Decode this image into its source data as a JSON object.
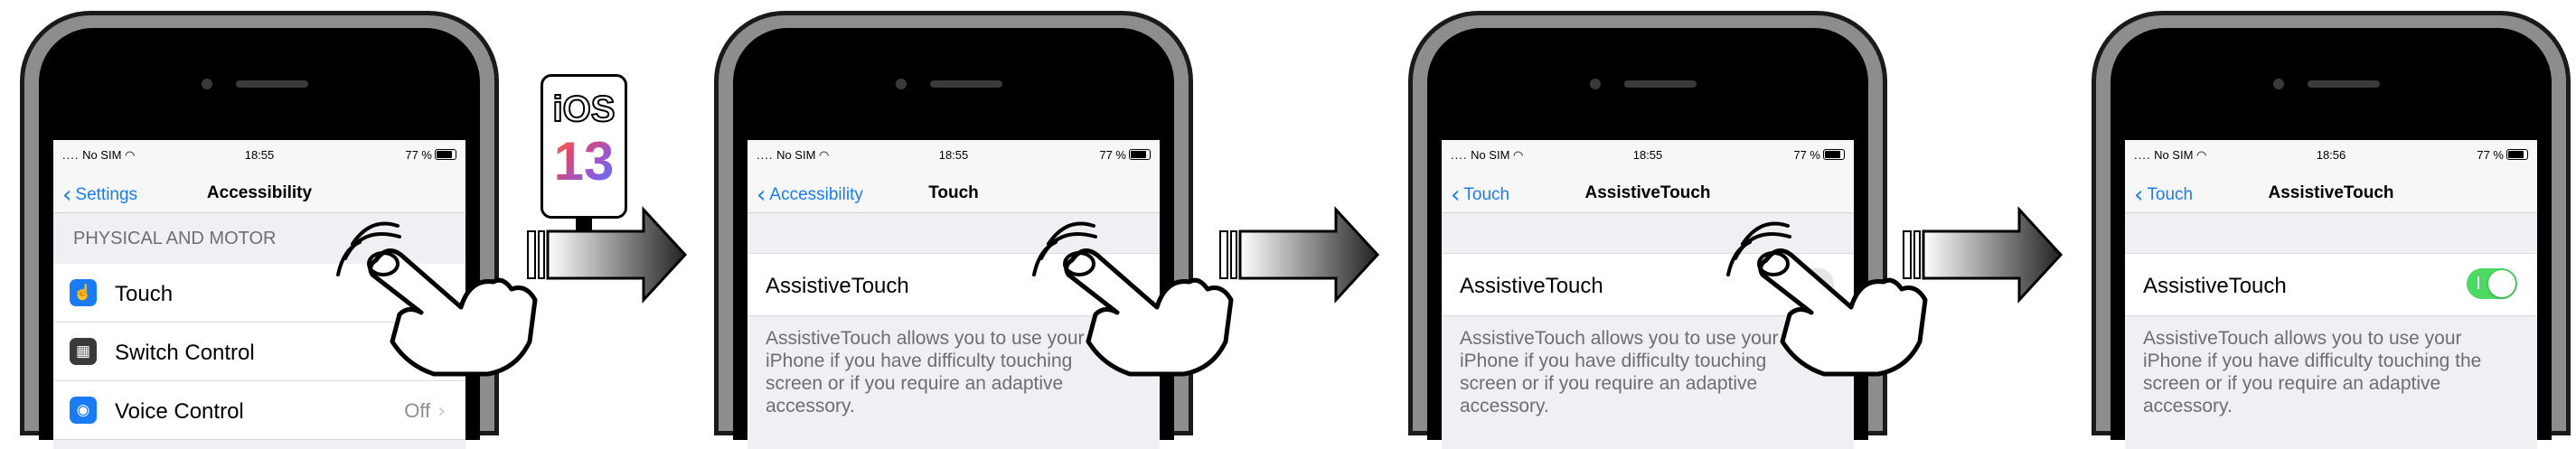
{
  "status": {
    "carrier": "No SIM",
    "battery": "77 %"
  },
  "screens": [
    {
      "time": "18:55",
      "back": "Settings",
      "title": "Accessibility",
      "section": "PHYSICAL AND MOTOR",
      "rows": [
        {
          "label": "Touch",
          "icon": "hand-pointer-icon",
          "color": "#1a7cf5",
          "value": ""
        },
        {
          "label": "Switch Control",
          "icon": "switch-grid-icon",
          "color": "#3a3a3c",
          "value": ""
        },
        {
          "label": "Voice Control",
          "icon": "voice-control-icon",
          "color": "#1a7cf5",
          "value": "Off"
        }
      ]
    },
    {
      "time": "18:55",
      "back": "Accessibility",
      "title": "Touch",
      "setting": "AssistiveTouch",
      "toggle_on": false,
      "desc_lines": [
        "AssistiveTouch allows you to use your",
        "iPhone if you have difficulty touching",
        "screen or if you require an adaptive",
        "accessory."
      ]
    },
    {
      "time": "18:55",
      "back": "Touch",
      "title": "AssistiveTouch",
      "setting": "AssistiveTouch",
      "toggle_on": false,
      "desc_lines": [
        "AssistiveTouch allows you to use your",
        "iPhone if you have difficulty touching",
        "screen or if you require an adaptive",
        "accessory."
      ]
    },
    {
      "time": "18:56",
      "back": "Touch",
      "title": "AssistiveTouch",
      "setting": "AssistiveTouch",
      "toggle_on": true,
      "desc_lines": [
        "AssistiveTouch allows you to use your",
        "iPhone if you have difficulty touching the",
        "screen or if you require an adaptive",
        "accessory."
      ]
    }
  ],
  "badge": {
    "line1": "iOS",
    "line2": "13"
  },
  "colors": {
    "accent": "#1a7cf5",
    "toggle_on": "#4cd964"
  }
}
